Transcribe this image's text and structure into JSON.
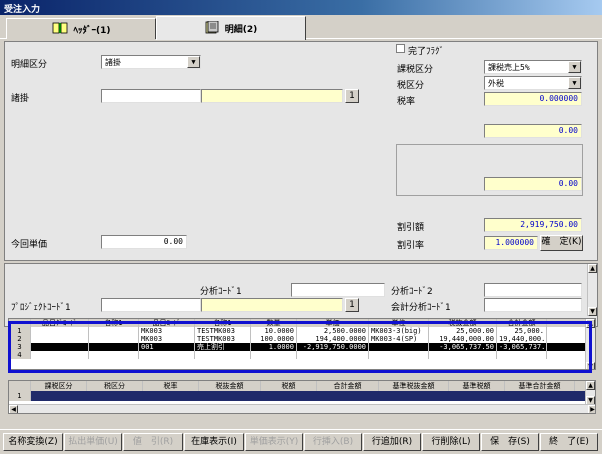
{
  "window": {
    "title": "受注入力"
  },
  "tabs": [
    {
      "label": "ﾍｯﾀﾞｰ(1)"
    },
    {
      "label": "明細(2)"
    }
  ],
  "detail": {
    "meisai_kubun_label": "明細区分",
    "meisai_kubun_value": "諸掛",
    "shokake_label": "諸掛",
    "shokake_value": "",
    "btn_1": "1",
    "kanryo_flag_label": "完了ﾌﾗｸﾞ",
    "kazei_kubun_label": "課税区分",
    "kazei_kubun_value": "課税売上5%",
    "zei_kubun_label": "税区分",
    "zei_kubun_value": "外税",
    "zeiritsu_label": "税率",
    "zeiritsu_value": "0.000000",
    "field_a_value": "0.00",
    "field_b_value": "0.00",
    "warihiki_gaku_label": "割引額",
    "warihiki_gaku_value": "2,919,750.00",
    "warihiki_ritsu_label": "割引率",
    "warihiki_ritsu_value": "1.000000",
    "kakutei_button": "確　定(K)",
    "konkai_tanka_label": "今回単価",
    "konkai_tanka_value": "0.00"
  },
  "analysis": {
    "bunseki1_label": "分析ｺｰﾄﾞ1",
    "bunseki2_label": "分析ｺｰﾄﾞ2",
    "project1_label": "ﾌﾟﾛｼﾞｪｸﾄｺｰﾄﾞ1",
    "kaikei_bunseki_label": "会計分析ｺｰﾄﾞ1",
    "btn_1": "1"
  },
  "grid1": {
    "headers": [
      "",
      "品目ｸﾞｺｰﾄﾞ",
      "名称1",
      "品目ｺｰﾄﾞ",
      "名称1",
      "数量",
      "単価",
      "単位",
      "税抜金額",
      "合計金額"
    ],
    "rows": [
      [
        "1",
        "",
        "",
        "MK003",
        "TESTMK003",
        "10.0000",
        "2,500.0000",
        "MK003-3(big)",
        "25,000.00",
        "25,000."
      ],
      [
        "2",
        "",
        "",
        "MK003",
        "TESTMK003",
        "100.0000",
        "194,400.0000",
        "MK003-4(SP)",
        "19,440,000.00",
        "19,440,000."
      ],
      [
        "3",
        "",
        "",
        "001",
        "売上割引",
        "1.0000",
        "-2,919,750.0000",
        "",
        "-3,065,737.50",
        "-3,065,737."
      ],
      [
        "4",
        "",
        "",
        "",
        "",
        "",
        "",
        "",
        "",
        ""
      ]
    ]
  },
  "grid2": {
    "headers": [
      "",
      "課税区分",
      "税区分",
      "税率",
      "税抜金額",
      "税額",
      "合計金額",
      "基準税抜金額",
      "基準税額",
      "基準合計金額"
    ],
    "rows": [
      [
        "1",
        "",
        "",
        "",
        "",
        "",
        "",
        "",
        "",
        ""
      ]
    ]
  },
  "bottom": {
    "buttons": [
      {
        "label": "名称変換(Z)",
        "enabled": true
      },
      {
        "label": "払出単価(U)",
        "enabled": false
      },
      {
        "label": "値　引(R)",
        "enabled": false
      },
      {
        "label": "在庫表示(I)",
        "enabled": true
      },
      {
        "label": "単価表示(Y)",
        "enabled": false
      },
      {
        "label": "行挿入(B)",
        "enabled": false
      },
      {
        "label": "行追加(R)",
        "enabled": true
      },
      {
        "label": "行削除(L)",
        "enabled": true
      },
      {
        "label": "保　存(S)",
        "enabled": true
      },
      {
        "label": "終　了(E)",
        "enabled": true
      }
    ]
  },
  "colors": {
    "titlebar": "#0a246a",
    "selection": "#1010d0",
    "field_yellow": "#ffffcc"
  }
}
